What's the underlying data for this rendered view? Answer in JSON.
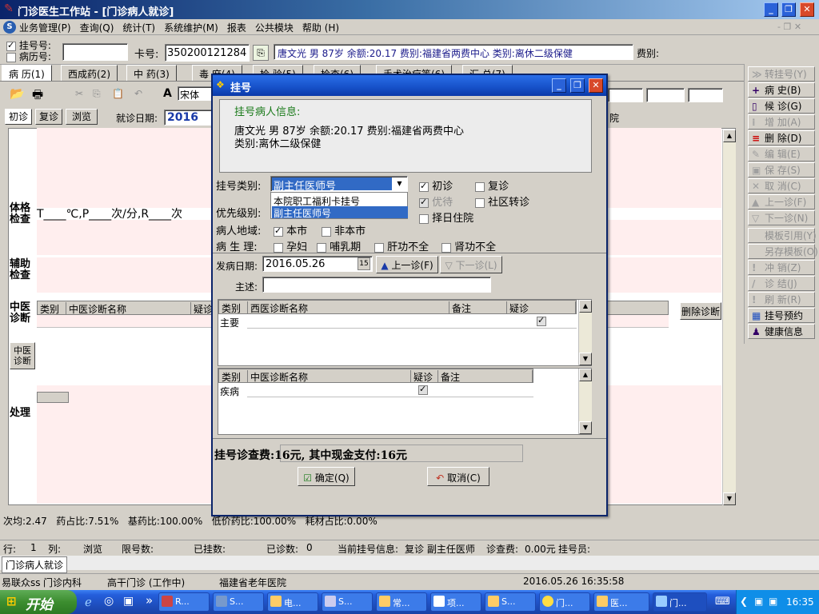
{
  "window": {
    "title": "门诊医生工作站 - [门诊病人就诊]",
    "min": "_",
    "max": "❐",
    "close": "✕"
  },
  "menu": [
    "业务管理(P)",
    "查询(Q)",
    "统计(T)",
    "系统维护(M)",
    "报表",
    "公共模块",
    "帮助 (H)"
  ],
  "patient_bar": {
    "reg_no_label": "挂号号:",
    "record_no_label": "病历号:",
    "card_label": "卡号:",
    "card_value": "350200121284",
    "patient_info": "唐文光 男 87岁 余额:20.17 费别:福建省两费中心 类别:离休二级保健",
    "fee_label": "费别:"
  },
  "tabs": [
    "病 历(1)",
    "西成药(2)",
    "中 药(3)",
    "毒 麻(4)",
    "检 验(5)",
    "检查(6)",
    "手术治疗等(6)",
    "汇 总(7)"
  ],
  "editor_toolbar": {
    "font_name": "宋体"
  },
  "subtabs": {
    "first": "初诊",
    "revisit": "复诊",
    "browse": "浏览",
    "date_label": "就诊日期:",
    "date_value": "2016年",
    "hospital_frag": "院"
  },
  "sections": {
    "physical_label": "体格检查",
    "physical_text": "T____℃,P____次/分,R____次",
    "aux_label": "辅助检查",
    "tcm_label": "中医诊断",
    "tcm_btn": "中医诊断",
    "treat_label": "处理",
    "tcm_grid": {
      "col1": "类别",
      "col2": "中医诊断名称",
      "col3": "疑诊"
    },
    "delete_diag": "删除诊断"
  },
  "right_buttons": [
    {
      "icon": "≫",
      "label": "转挂号(Y)",
      "enabled": false
    },
    {
      "icon": "+",
      "label": "病 史(B)",
      "enabled": true
    },
    {
      "icon": "▯",
      "label": "候 诊(G)",
      "enabled": true
    },
    {
      "icon": "⁞",
      "label": "增 加(A)",
      "enabled": false
    },
    {
      "icon": "≡",
      "label": "删 除(D)",
      "enabled": true
    },
    {
      "icon": "✎",
      "label": "编 辑(E)",
      "enabled": false
    },
    {
      "icon": "▣",
      "label": "保 存(S)",
      "enabled": false
    },
    {
      "icon": "✕",
      "label": "取 消(C)",
      "enabled": false
    },
    {
      "icon": "▲",
      "label": "上一诊(F)",
      "enabled": false
    },
    {
      "icon": "▽",
      "label": "下一诊(N)",
      "enabled": false
    },
    {
      "icon": " ",
      "label": "模板引用(Y)",
      "enabled": false
    },
    {
      "icon": " ",
      "label": "另存模板(O)",
      "enabled": false
    },
    {
      "icon": "!",
      "label": "冲 销(Z)",
      "enabled": false
    },
    {
      "icon": "/",
      "label": "诊 结(J)",
      "enabled": false
    },
    {
      "icon": "!",
      "label": "刷 新(R)",
      "enabled": false
    },
    {
      "icon": "▦",
      "label": "挂号预约",
      "enabled": true
    },
    {
      "icon": "♟",
      "label": "健康信息",
      "enabled": true
    }
  ],
  "stats": {
    "text": "次均:2.47   药占比:7.51%   基药比:100.00%   低价药比:100.00%   耗材占比:0.00%"
  },
  "status1": {
    "row_label": "行:",
    "row_value": "1",
    "col_label": "列:",
    "browse": "浏览",
    "limit_label": "限号数:",
    "registered_label": "已挂数:",
    "diagnosed_label": "已诊数:",
    "diagnosed_value": "0",
    "current_label": "当前挂号信息:",
    "current_value": "复诊 副主任医师",
    "fee_label": "诊查费:",
    "fee_value": "0.00元",
    "staff_label": "挂号员:"
  },
  "status2": {
    "tab": "门诊病人就诊"
  },
  "status3": {
    "user": "易联众ss",
    "dept": "门诊内科",
    "clinic": "高干门诊 (工作中)",
    "hospital": "福建省老年医院",
    "datetime": "2016.05.26 16:35:58"
  },
  "dialog": {
    "title": "挂号",
    "info_heading": "挂号病人信息:",
    "info_line1": "唐文光 男 87岁 余额:20.17 费别:福建省两费中心",
    "info_line2": "类别:离休二级保健",
    "type_label": "挂号类别:",
    "type_selected": "副主任医师号",
    "type_options": [
      "本院职工福利卡挂号",
      "副主任医师号"
    ],
    "first_visit": "初诊",
    "revisit": "复诊",
    "priority_label": "优先级别:",
    "priority_wait": "优待",
    "community": "社区转诊",
    "choose_date": "择日住院",
    "region_label": "病人地域:",
    "local": "本市",
    "nonlocal": "非本市",
    "physio_label": "病 生 理:",
    "pregnant": "孕妇",
    "lactation": "哺乳期",
    "liver": "肝功不全",
    "kidney": "肾功不全",
    "onset_label": "发病日期:",
    "onset_value": "2016.05.26",
    "prev_visit": "上一诊(F)",
    "next_visit": "下一诊(L)",
    "complaint_label": "主述:",
    "west_grid": {
      "col1": "类别",
      "col2": "西医诊断名称",
      "col3": "备注",
      "col4": "疑诊",
      "row1": "主要"
    },
    "tcm_grid": {
      "col1": "类别",
      "col2": "中医诊断名称",
      "col3": "疑诊",
      "col4": "备注",
      "row1": "疾病"
    },
    "fee_text": "挂号诊查费:16元, 其中现金支付:16元",
    "ok": "确定(Q)",
    "cancel": "取消(C)"
  },
  "taskbar": {
    "start": "开始",
    "items": [
      "R...",
      "S...",
      "电...",
      "S...",
      "常...",
      "项...",
      "S...",
      "门...",
      "医...",
      "门..."
    ],
    "clock": "16:35"
  }
}
